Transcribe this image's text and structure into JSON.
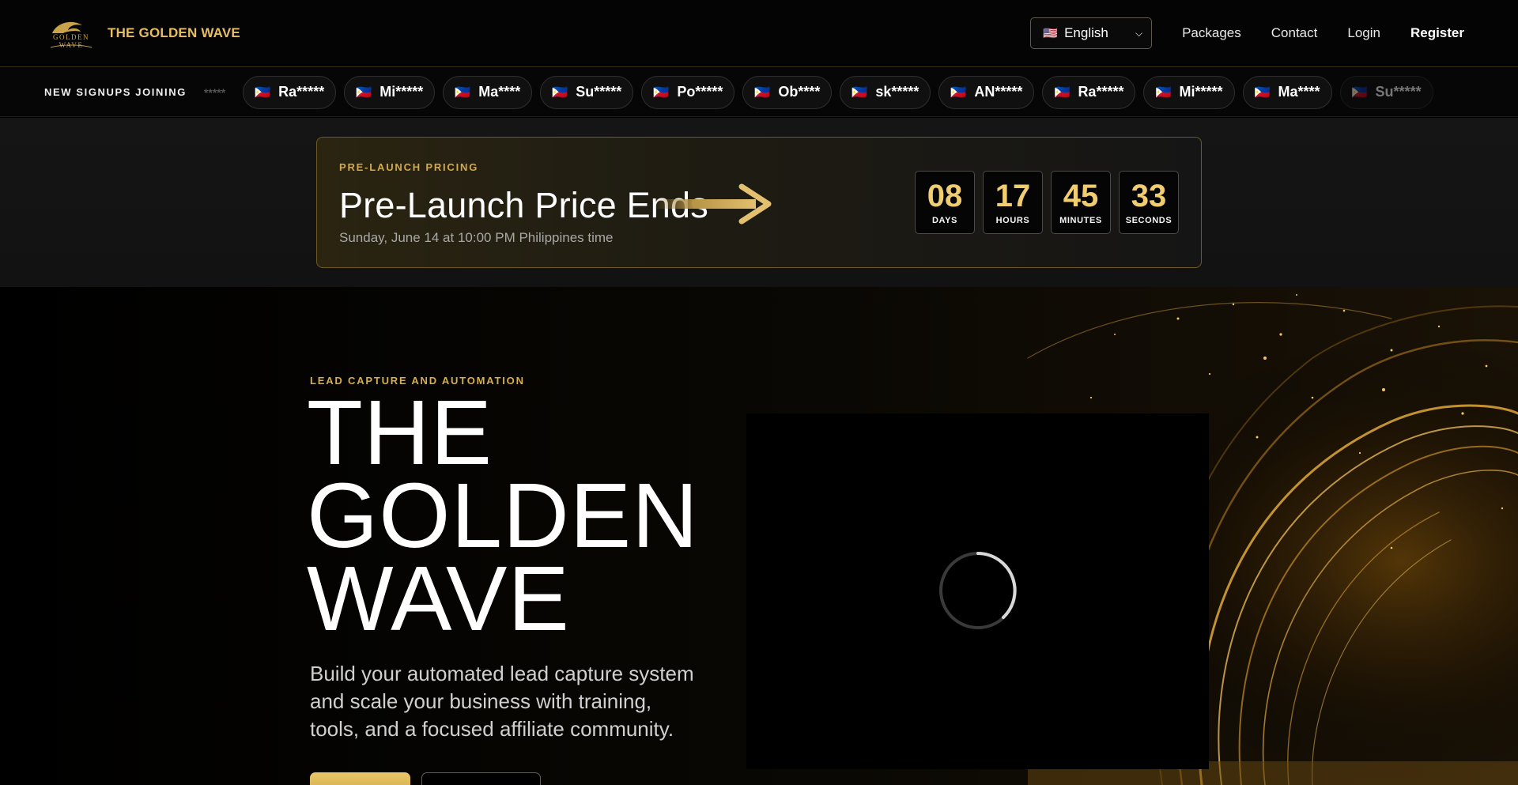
{
  "header": {
    "brand_name": "THE GOLDEN WAVE",
    "logo_text": "GOLDEN WAVE",
    "language": {
      "flag": "🇺🇸",
      "selected": "English"
    },
    "links": [
      "Packages",
      "Contact",
      "Login",
      "Register"
    ]
  },
  "ticker": {
    "label": "NEW SIGNUPS JOINING",
    "leading_fragment": "*****",
    "signups": [
      {
        "flag": "🇵🇭",
        "name": "Ra*****"
      },
      {
        "flag": "🇵🇭",
        "name": "Mi*****"
      },
      {
        "flag": "🇵🇭",
        "name": "Ma****"
      },
      {
        "flag": "🇵🇭",
        "name": "Su*****"
      },
      {
        "flag": "🇵🇭",
        "name": "Po*****"
      },
      {
        "flag": "🇵🇭",
        "name": "Ob****"
      },
      {
        "flag": "🇵🇭",
        "name": "sk*****"
      },
      {
        "flag": "🇵🇭",
        "name": "AN*****"
      },
      {
        "flag": "🇵🇭",
        "name": "Ra*****"
      },
      {
        "flag": "🇵🇭",
        "name": "Mi*****"
      },
      {
        "flag": "🇵🇭",
        "name": "Ma****"
      },
      {
        "flag": "🇵🇭",
        "name": "Su*****"
      }
    ]
  },
  "promo": {
    "eyebrow": "PRE-LAUNCH PRICING",
    "title": "Pre-Launch Price Ends",
    "subtitle": "Sunday, June 14 at 10:00 PM Philippines time",
    "countdown": [
      {
        "value": "08",
        "label": "DAYS"
      },
      {
        "value": "17",
        "label": "HOURS"
      },
      {
        "value": "45",
        "label": "MINUTES"
      },
      {
        "value": "33",
        "label": "SECONDS"
      }
    ]
  },
  "hero": {
    "eyebrow": "LEAD CAPTURE AND AUTOMATION",
    "title_lines": [
      "THE",
      "GOLDEN",
      "WAVE"
    ],
    "description": "Build your automated lead capture system and scale your business with training, tools, and a focused affiliate community."
  },
  "colors": {
    "accent_gold": "#e7bf62",
    "countdown_number": "#f1cd71",
    "background": "#000000"
  }
}
